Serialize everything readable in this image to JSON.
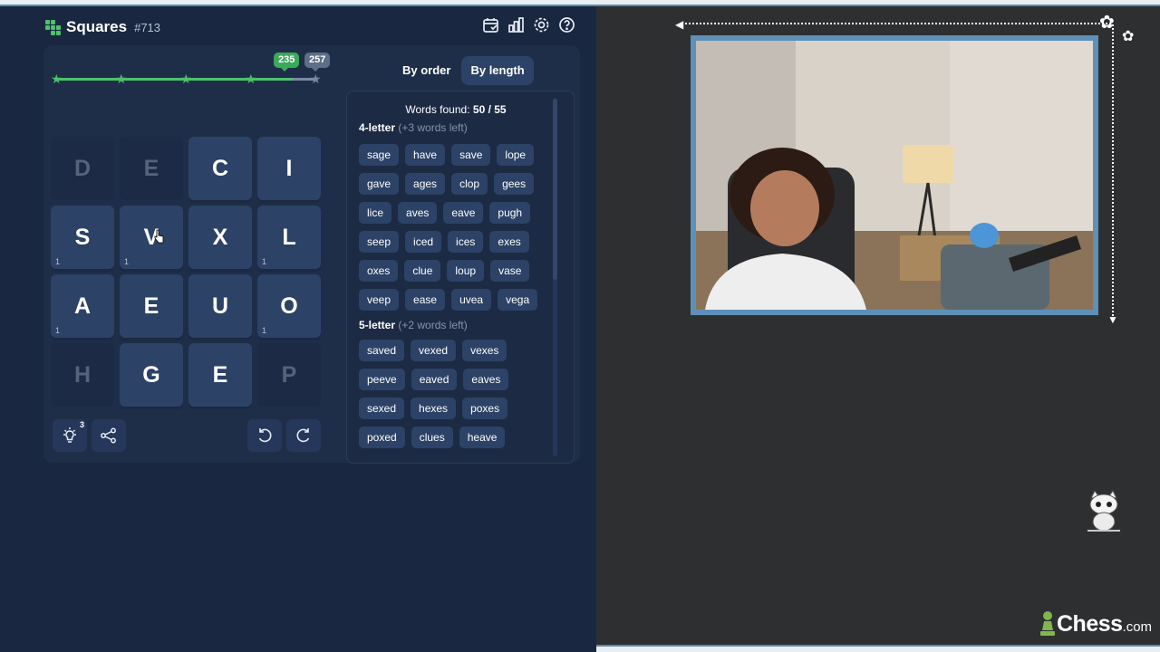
{
  "app": {
    "title": "Squares",
    "puzzle_number": "#713"
  },
  "header_icons": [
    "calendar-icon",
    "stats-icon",
    "settings-icon",
    "help-icon"
  ],
  "progress": {
    "level": 0.91,
    "score_badge": "235",
    "max_badge": "257",
    "stars_earned": 4,
    "stars_total": 5
  },
  "grid": [
    [
      {
        "letter": "D",
        "count": "",
        "active": false
      },
      {
        "letter": "E",
        "count": "",
        "active": false
      },
      {
        "letter": "C",
        "count": "",
        "active": true
      },
      {
        "letter": "I",
        "count": "",
        "active": true
      }
    ],
    [
      {
        "letter": "S",
        "count": "1",
        "active": true
      },
      {
        "letter": "V",
        "count": "1",
        "active": true
      },
      {
        "letter": "X",
        "count": "",
        "active": true
      },
      {
        "letter": "L",
        "count": "1",
        "active": true
      }
    ],
    [
      {
        "letter": "A",
        "count": "1",
        "active": true
      },
      {
        "letter": "E",
        "count": "",
        "active": true
      },
      {
        "letter": "U",
        "count": "",
        "active": true
      },
      {
        "letter": "O",
        "count": "1",
        "active": true
      }
    ],
    [
      {
        "letter": "H",
        "count": "",
        "active": false
      },
      {
        "letter": "G",
        "count": "",
        "active": true
      },
      {
        "letter": "E",
        "count": "",
        "active": true
      },
      {
        "letter": "P",
        "count": "",
        "active": false
      }
    ]
  ],
  "controls": {
    "hint_count": "3"
  },
  "tabs": {
    "by_order": "By order",
    "by_length": "By length"
  },
  "words": {
    "found_label": "Words found:",
    "found_value": "50 / 55",
    "sections": [
      {
        "title": "4-letter",
        "remaining": "(+3 words left)",
        "words": [
          "sage",
          "have",
          "save",
          "lope",
          "gave",
          "ages",
          "clop",
          "gees",
          "lice",
          "aves",
          "eave",
          "pugh",
          "seep",
          "iced",
          "ices",
          "exes",
          "oxes",
          "clue",
          "loup",
          "vase",
          "veep",
          "ease",
          "uvea",
          "vega"
        ]
      },
      {
        "title": "5-letter",
        "remaining": "(+2 words left)",
        "words": [
          "saved",
          "vexed",
          "vexes",
          "peeve",
          "eaved",
          "eaves",
          "sexed",
          "hexes",
          "poxes",
          "poxed",
          "clues",
          "heave"
        ]
      }
    ]
  },
  "brand": {
    "name": "Chess",
    "domain": ".com"
  },
  "colors": {
    "accent_green": "#4cc36b",
    "panel_bg": "#1a2740",
    "tile": "#2c4266",
    "frame": "#5f90b8"
  }
}
